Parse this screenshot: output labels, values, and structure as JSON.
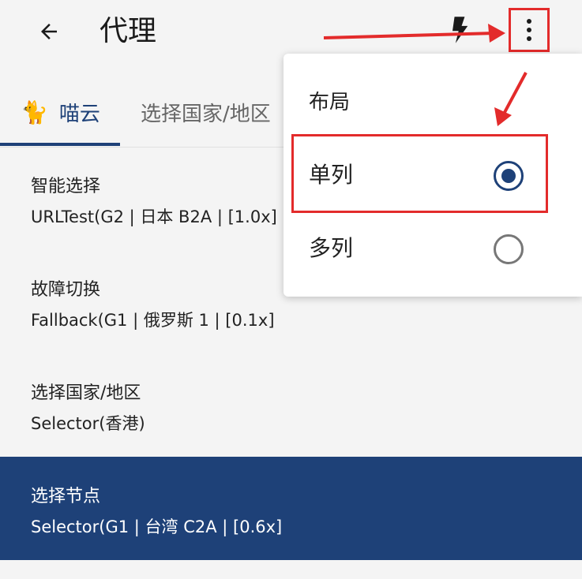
{
  "header": {
    "title": "代理"
  },
  "tabs": [
    {
      "icon": "🐈",
      "label": "喵云"
    },
    {
      "label": "选择国家/地区"
    }
  ],
  "proxy_groups": [
    {
      "name": "智能选择",
      "value": "URLTest(G2 | 日本 B2A | [1.0x] |"
    },
    {
      "name": "故障切换",
      "value": "Fallback(G1 | 俄罗斯 1 | [0.1x]"
    },
    {
      "name": "选择国家/地区",
      "value": "Selector(香港)"
    },
    {
      "name": "选择节点",
      "value": "Selector(G1 | 台湾 C2A | [0.6x]",
      "selected": true
    }
  ],
  "menu": {
    "header": "布局",
    "options": [
      {
        "label": "单列",
        "checked": true
      },
      {
        "label": "多列",
        "checked": false
      }
    ]
  },
  "colors": {
    "primary": "#1e4178",
    "annotation": "#e32b2b",
    "background": "#f4f4f4"
  },
  "icons": {
    "back": "arrow-left-icon",
    "bolt": "lightning-icon",
    "more": "more-vert-icon"
  }
}
